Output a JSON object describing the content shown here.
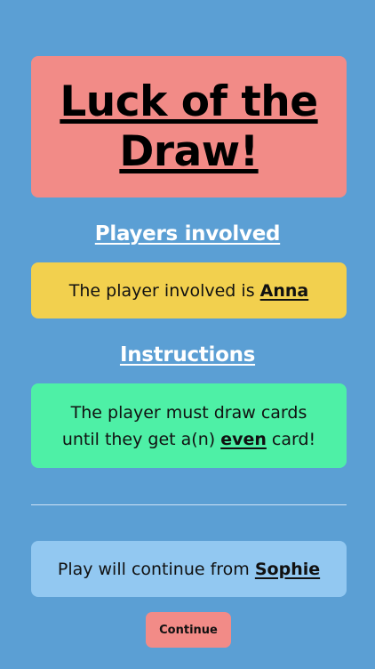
{
  "title": "Luck of the Draw!",
  "players": {
    "heading": "Players involved",
    "text_prefix": "The player involved is ",
    "player_name": "Anna"
  },
  "instructions": {
    "heading": "Instructions",
    "line1": "The player must draw cards",
    "line2_prefix": "until they get a(n) ",
    "card_type": "even",
    "line2_suffix": " card!"
  },
  "continue_info": {
    "text_prefix": "Play will continue from ",
    "next_player": "Sophie"
  },
  "continue_button_label": "Continue",
  "colors": {
    "background": "#5b9fd4",
    "title_card": "#f28b87",
    "players_card": "#f2d04e",
    "instructions_card": "#4ef0a6",
    "continue_card": "#92c8f1",
    "button": "#f28b87"
  }
}
